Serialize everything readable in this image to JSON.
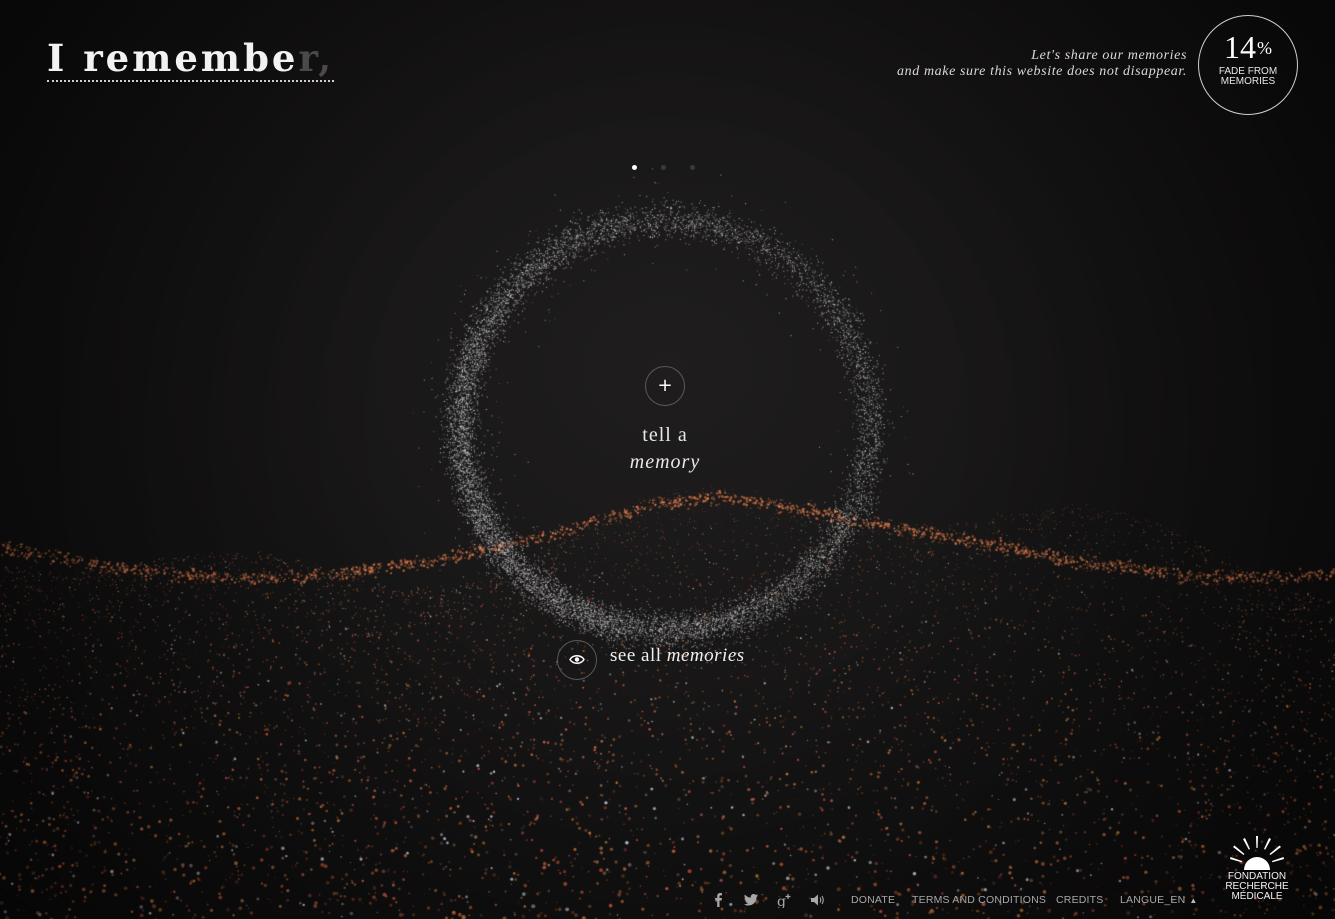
{
  "logo": {
    "visible": "I remembe",
    "faded": "r,",
    "title": "I remember,"
  },
  "tagline": {
    "line1": "Let's share our memories",
    "line2": "and make sure this website does not disappear."
  },
  "fade_badge": {
    "value": "14",
    "unit": "%",
    "label": "FADE FROM MEMORIES"
  },
  "pager": {
    "count": 3,
    "active_index": 0
  },
  "cta": {
    "icon": "plus-icon",
    "line1": "tell a",
    "line2": "memory"
  },
  "see_all": {
    "icon": "eye-icon",
    "text": "see all",
    "emph": "memories"
  },
  "social": [
    "facebook-icon",
    "twitter-icon",
    "google-plus-icon",
    "sound-icon"
  ],
  "footer": {
    "donate": "DONATE",
    "terms": "TERMS AND CONDITIONS",
    "credits": "CREDITS",
    "language": "LANGUE_EN"
  },
  "foundation": {
    "line1": "FONDATION",
    "line2": "RECHERCHE",
    "line3": "MÉDICALE"
  },
  "colors": {
    "background": "#151414",
    "accent": "#ffffff",
    "sparks": "#e07b4a"
  }
}
